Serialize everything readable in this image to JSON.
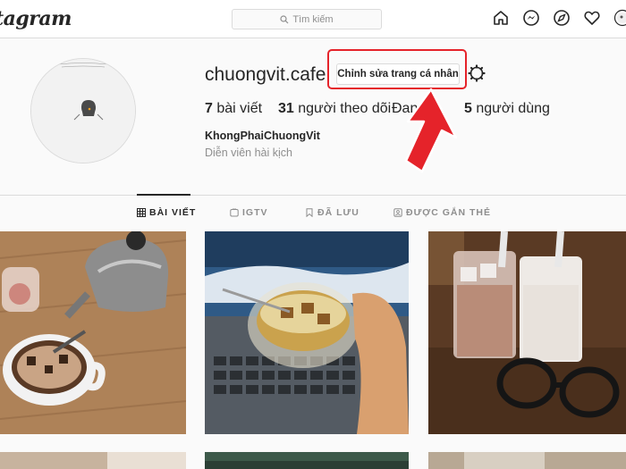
{
  "header": {
    "logo_text": "Instagram",
    "search_placeholder": "Tìm kiếm",
    "nav_icons": [
      "home-icon",
      "messenger-icon",
      "explore-icon",
      "activity-heart-icon",
      "profile-avatar-icon"
    ]
  },
  "profile": {
    "username": "chuongvit.cafe",
    "edit_button_label": "Chỉnh sửa trang cá nhân",
    "settings_icon": "gear-icon",
    "stats": {
      "posts_count": "7",
      "posts_label": " bài viết",
      "followers_count": "31",
      "followers_label": " người theo dõi",
      "following_prefix": "Đang",
      "following_count": "5",
      "following_label": " người dùng"
    },
    "full_name": "KhongPhaiChuongVit",
    "bio": "Diễn viên hài kịch"
  },
  "tabs": [
    {
      "label": "BÀI VIẾT",
      "icon": "grid-icon",
      "active": true
    },
    {
      "label": "IGTV",
      "icon": "igtv-icon",
      "active": false
    },
    {
      "label": "ĐÃ LƯU",
      "icon": "bookmark-icon",
      "active": false
    },
    {
      "label": "ĐƯỢC GẮN THẺ",
      "icon": "tag-icon",
      "active": false
    }
  ],
  "colors": {
    "annotation_red": "#e5232a",
    "border": "#dbdbdb",
    "text": "#262626",
    "muted": "#8e8e8e"
  }
}
